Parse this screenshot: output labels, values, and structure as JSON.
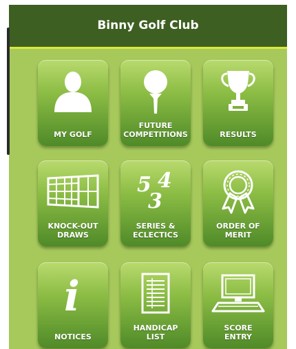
{
  "header": {
    "title": "Binny Golf Club"
  },
  "tiles": [
    {
      "label": "MY GOLF",
      "icon": "person-silhouette-icon"
    },
    {
      "label": "FUTURE\nCOMPETITIONS",
      "icon": "golf-ball-on-tee-icon"
    },
    {
      "label": "RESULTS",
      "icon": "trophy-icon"
    },
    {
      "label": "KNOCK-OUT\nDRAWS",
      "icon": "bracket-grid-icon"
    },
    {
      "label": "SERIES &\nECLECTICS",
      "icon": "numbers-icon",
      "icon_text": {
        "a": "5",
        "b": "3",
        "c": "4"
      }
    },
    {
      "label": "ORDER OF\nMERIT",
      "icon": "rosette-icon"
    },
    {
      "label": "NOTICES",
      "icon": "info-icon",
      "icon_text": "i"
    },
    {
      "label": "HANDICAP\nLIST",
      "icon": "list-document-icon"
    },
    {
      "label": "SCORE\nENTRY",
      "icon": "computer-icon"
    }
  ],
  "colors": {
    "header_bg": "#3e5f22",
    "header_border": "#d8ea3a",
    "app_bg": "#a7c95c",
    "tile_top": "#b9da6e",
    "tile_bottom": "#4f8a28",
    "icon_fill": "#ffffff"
  }
}
